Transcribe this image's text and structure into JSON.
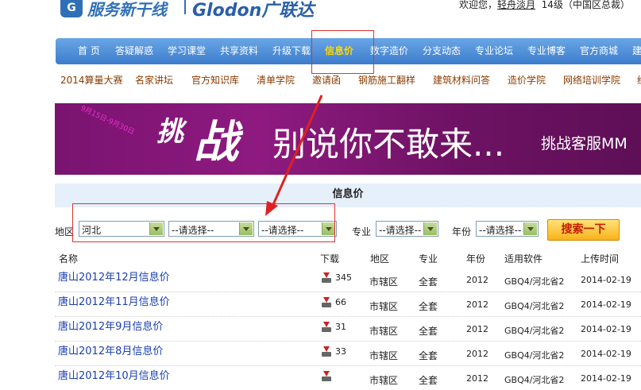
{
  "header": {
    "logo_icon": "G",
    "logo_cn": "服务新干线",
    "logo_en": "Glodon广联达",
    "welcome": "欢迎您，",
    "username": "轻舟淡月",
    "level": "14级（中国区总裁）"
  },
  "mainnav": [
    {
      "label": "首 页",
      "active": false
    },
    {
      "label": "答疑解惑",
      "active": false
    },
    {
      "label": "学习课堂",
      "active": false
    },
    {
      "label": "共享资料",
      "active": false
    },
    {
      "label": "升级下载",
      "active": false
    },
    {
      "label": "信息价",
      "active": true
    },
    {
      "label": "数字造价",
      "active": false
    },
    {
      "label": "分支动态",
      "active": false
    },
    {
      "label": "专业论坛",
      "active": false
    },
    {
      "label": "专业博客",
      "active": false
    },
    {
      "label": "官方商城",
      "active": false
    },
    {
      "label": "建",
      "active": false
    }
  ],
  "subnav": [
    "2014算量大赛",
    "名家讲坛",
    "官方知识库",
    "清单学院",
    "邀请函",
    "钢筋施工翻样",
    "建筑材料问答",
    "造价学院",
    "网络培训学院",
    "经"
  ],
  "banner": {
    "date": "9月15日-9月30日",
    "tiao": "挑",
    "zhan": "战",
    "slogan": "别说你不敢来...",
    "sub": "挑战客服MM"
  },
  "section": {
    "title": "信息价"
  },
  "filters": {
    "region_label": "地区",
    "province": "河北",
    "city": "--请选择--",
    "county": "--请选择--",
    "major_label": "专业",
    "major": "--请选择--",
    "year_label": "年份",
    "year": "--请选择--",
    "search_label": "搜索一下"
  },
  "table": {
    "headers": [
      "名称",
      "下载",
      "地区",
      "专业",
      "年份",
      "适用软件",
      "上传时间"
    ],
    "rows": [
      {
        "name": "唐山2012年12月信息价",
        "downloads": "345",
        "region": "市辖区",
        "major": "全套",
        "year": "2012",
        "software": "GBQ4/河北省2",
        "date": "2014-02-19"
      },
      {
        "name": "唐山2012年11月信息价",
        "downloads": "66",
        "region": "市辖区",
        "major": "全套",
        "year": "2012",
        "software": "GBQ4/河北省2",
        "date": "2014-02-19"
      },
      {
        "name": "唐山2012年9月信息价",
        "downloads": "31",
        "region": "市辖区",
        "major": "全套",
        "year": "2012",
        "software": "GBQ4/河北省2",
        "date": "2014-02-19"
      },
      {
        "name": "唐山2012年8月信息价",
        "downloads": "33",
        "region": "市辖区",
        "major": "全套",
        "year": "2012",
        "software": "GBQ4/河北省2",
        "date": "2014-02-19"
      },
      {
        "name": "唐山2012年10月信息价",
        "downloads": "",
        "region": "市辖区",
        "major": "全套",
        "year": "2012",
        "software": "GBQ4/河北省2",
        "date": "2014-02-19"
      }
    ]
  },
  "colors": {
    "accent": "#3c7ccc",
    "highlight": "#dd3333",
    "link": "#1a3fb0"
  }
}
